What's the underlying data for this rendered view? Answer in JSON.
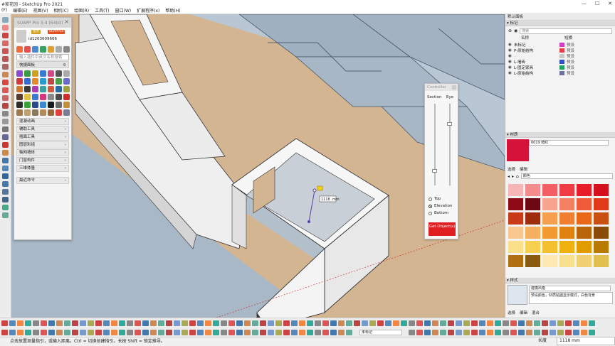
{
  "window": {
    "title": "某家花园 - SketchUp Pro 2021",
    "title_visible": "#家花园 - SketchUp Pro 2021",
    "minimize": "—",
    "maximize": "☐",
    "close": "✕"
  },
  "menu": [
    "(F)",
    "编辑(E)",
    "视图(V)",
    "相机(C)",
    "绘图(R)",
    "工具(T)",
    "窗口(W)",
    "扩展程序(x)",
    "帮助(H)"
  ],
  "suapp": {
    "title": "SUAPP Pro 3.4 (64bit)",
    "close": "×",
    "badge_gold": "金牌",
    "badge_version": "SUAPP34",
    "user_id": "id1203609666",
    "search_placeholder": "输入插件中英文名称搜索",
    "section_label": "快捷面板",
    "categories": [
      "混凝动画",
      "辅助工具",
      "插面工具",
      "图层彩组",
      "轴网墙体",
      "门窗构件",
      "三维体量"
    ],
    "recent": "最近命令",
    "arrow": "›"
  },
  "controller": {
    "title": "Controller",
    "section": "Section",
    "eye": "Eye",
    "options": [
      {
        "label": "Top",
        "checked": false
      },
      {
        "label": "Elevation",
        "checked": true
      },
      {
        "label": "Bottom",
        "checked": false
      }
    ],
    "button": "Get Object(s)"
  },
  "viewport": {
    "dimension_text": "1118 .mm"
  },
  "right": {
    "tray_title": "默认面板",
    "tags_title": "标记",
    "search_placeholder": "搜索",
    "col_name": "名称",
    "col_line": "短横",
    "tags": [
      {
        "name": "未标记",
        "color": "#d040c0",
        "line": "预设"
      },
      {
        "name": "P-原始结构",
        "color": "#e8404a",
        "line": "预设"
      },
      {
        "name": "…",
        "color": "#c8c8c8",
        "line": "预设"
      },
      {
        "name": "L-墙砖",
        "color": "#3050c0",
        "line": "预设"
      },
      {
        "name": "L-固定家具",
        "color": "#20a060",
        "line": "预设"
      },
      {
        "name": "L-原始结构",
        "color": "#7070a0",
        "line": "预设"
      }
    ],
    "materials_title": "材质",
    "material_name": "0019 暗红",
    "material_color": "#d5133a",
    "mat_tab_select": "选择",
    "mat_tab_edit": "编辑",
    "mat_category": "颜色",
    "palette": [
      "#f6b6b8",
      "#f48c8e",
      "#f26066",
      "#f03c45",
      "#e81d2a",
      "#d4101e",
      "#8e0a14",
      "#6e0812",
      "#f7a48c",
      "#f48064",
      "#ef5c3a",
      "#e03a1a",
      "#c83a18",
      "#a02c10",
      "#f4a050",
      "#f08030",
      "#e86818",
      "#c85010",
      "#f8c890",
      "#f4b060",
      "#f09a30",
      "#e08010",
      "#b86408",
      "#8a4a08",
      "#fbe08a",
      "#f8d050",
      "#f4c030",
      "#f0b010",
      "#e09c00",
      "#b87a00",
      "#b07010",
      "#8a5a10",
      "#fce8b0",
      "#f8e090",
      "#f0d070",
      "#e0c050"
    ],
    "styles_title": "样式",
    "style_name": "建模风格",
    "style_desc": "预设颜色，材质贴图显示模式，白色背景",
    "style_tab_select": "选择",
    "style_tab_edit": "编辑",
    "style_tab_mix": "混合"
  },
  "bottom": {
    "tag_dropdown": "未标记"
  },
  "status": {
    "hint": "点击放置测量指引，或输入距离。Ctrl = 切换创建指引。长按 Shift = 锁定推导。",
    "measure_label": "长度",
    "measure_value": "1118 mm"
  }
}
